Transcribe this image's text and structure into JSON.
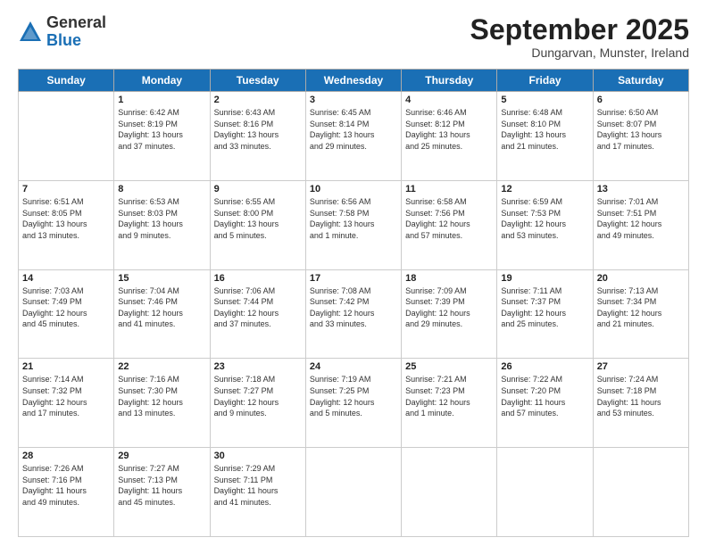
{
  "logo": {
    "general": "General",
    "blue": "Blue"
  },
  "header": {
    "month": "September 2025",
    "location": "Dungarvan, Munster, Ireland"
  },
  "weekdays": [
    "Sunday",
    "Monday",
    "Tuesday",
    "Wednesday",
    "Thursday",
    "Friday",
    "Saturday"
  ],
  "weeks": [
    [
      {
        "day": "",
        "info": ""
      },
      {
        "day": "1",
        "info": "Sunrise: 6:42 AM\nSunset: 8:19 PM\nDaylight: 13 hours\nand 37 minutes."
      },
      {
        "day": "2",
        "info": "Sunrise: 6:43 AM\nSunset: 8:16 PM\nDaylight: 13 hours\nand 33 minutes."
      },
      {
        "day": "3",
        "info": "Sunrise: 6:45 AM\nSunset: 8:14 PM\nDaylight: 13 hours\nand 29 minutes."
      },
      {
        "day": "4",
        "info": "Sunrise: 6:46 AM\nSunset: 8:12 PM\nDaylight: 13 hours\nand 25 minutes."
      },
      {
        "day": "5",
        "info": "Sunrise: 6:48 AM\nSunset: 8:10 PM\nDaylight: 13 hours\nand 21 minutes."
      },
      {
        "day": "6",
        "info": "Sunrise: 6:50 AM\nSunset: 8:07 PM\nDaylight: 13 hours\nand 17 minutes."
      }
    ],
    [
      {
        "day": "7",
        "info": "Sunrise: 6:51 AM\nSunset: 8:05 PM\nDaylight: 13 hours\nand 13 minutes."
      },
      {
        "day": "8",
        "info": "Sunrise: 6:53 AM\nSunset: 8:03 PM\nDaylight: 13 hours\nand 9 minutes."
      },
      {
        "day": "9",
        "info": "Sunrise: 6:55 AM\nSunset: 8:00 PM\nDaylight: 13 hours\nand 5 minutes."
      },
      {
        "day": "10",
        "info": "Sunrise: 6:56 AM\nSunset: 7:58 PM\nDaylight: 13 hours\nand 1 minute."
      },
      {
        "day": "11",
        "info": "Sunrise: 6:58 AM\nSunset: 7:56 PM\nDaylight: 12 hours\nand 57 minutes."
      },
      {
        "day": "12",
        "info": "Sunrise: 6:59 AM\nSunset: 7:53 PM\nDaylight: 12 hours\nand 53 minutes."
      },
      {
        "day": "13",
        "info": "Sunrise: 7:01 AM\nSunset: 7:51 PM\nDaylight: 12 hours\nand 49 minutes."
      }
    ],
    [
      {
        "day": "14",
        "info": "Sunrise: 7:03 AM\nSunset: 7:49 PM\nDaylight: 12 hours\nand 45 minutes."
      },
      {
        "day": "15",
        "info": "Sunrise: 7:04 AM\nSunset: 7:46 PM\nDaylight: 12 hours\nand 41 minutes."
      },
      {
        "day": "16",
        "info": "Sunrise: 7:06 AM\nSunset: 7:44 PM\nDaylight: 12 hours\nand 37 minutes."
      },
      {
        "day": "17",
        "info": "Sunrise: 7:08 AM\nSunset: 7:42 PM\nDaylight: 12 hours\nand 33 minutes."
      },
      {
        "day": "18",
        "info": "Sunrise: 7:09 AM\nSunset: 7:39 PM\nDaylight: 12 hours\nand 29 minutes."
      },
      {
        "day": "19",
        "info": "Sunrise: 7:11 AM\nSunset: 7:37 PM\nDaylight: 12 hours\nand 25 minutes."
      },
      {
        "day": "20",
        "info": "Sunrise: 7:13 AM\nSunset: 7:34 PM\nDaylight: 12 hours\nand 21 minutes."
      }
    ],
    [
      {
        "day": "21",
        "info": "Sunrise: 7:14 AM\nSunset: 7:32 PM\nDaylight: 12 hours\nand 17 minutes."
      },
      {
        "day": "22",
        "info": "Sunrise: 7:16 AM\nSunset: 7:30 PM\nDaylight: 12 hours\nand 13 minutes."
      },
      {
        "day": "23",
        "info": "Sunrise: 7:18 AM\nSunset: 7:27 PM\nDaylight: 12 hours\nand 9 minutes."
      },
      {
        "day": "24",
        "info": "Sunrise: 7:19 AM\nSunset: 7:25 PM\nDaylight: 12 hours\nand 5 minutes."
      },
      {
        "day": "25",
        "info": "Sunrise: 7:21 AM\nSunset: 7:23 PM\nDaylight: 12 hours\nand 1 minute."
      },
      {
        "day": "26",
        "info": "Sunrise: 7:22 AM\nSunset: 7:20 PM\nDaylight: 11 hours\nand 57 minutes."
      },
      {
        "day": "27",
        "info": "Sunrise: 7:24 AM\nSunset: 7:18 PM\nDaylight: 11 hours\nand 53 minutes."
      }
    ],
    [
      {
        "day": "28",
        "info": "Sunrise: 7:26 AM\nSunset: 7:16 PM\nDaylight: 11 hours\nand 49 minutes."
      },
      {
        "day": "29",
        "info": "Sunrise: 7:27 AM\nSunset: 7:13 PM\nDaylight: 11 hours\nand 45 minutes."
      },
      {
        "day": "30",
        "info": "Sunrise: 7:29 AM\nSunset: 7:11 PM\nDaylight: 11 hours\nand 41 minutes."
      },
      {
        "day": "",
        "info": ""
      },
      {
        "day": "",
        "info": ""
      },
      {
        "day": "",
        "info": ""
      },
      {
        "day": "",
        "info": ""
      }
    ]
  ]
}
